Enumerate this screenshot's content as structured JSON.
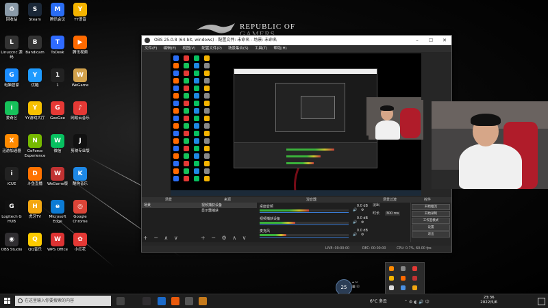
{
  "wallpaper": {
    "brand_line1": "REPUBLIC OF",
    "brand_line2": "GAMERS"
  },
  "desktop_icons": [
    {
      "label": "回收站",
      "color": "#8a9aa8",
      "glyph": "♻"
    },
    {
      "label": "Steam",
      "color": "#1b2838",
      "glyph": "S"
    },
    {
      "label": "腾讯会议",
      "color": "#2a6df4",
      "glyph": "M"
    },
    {
      "label": "YY语音",
      "color": "#f5b400",
      "glyph": "Y"
    },
    {
      "label": "Linuxcnc 源码",
      "color": "#333",
      "glyph": "L"
    },
    {
      "label": "Bandicam",
      "color": "#333",
      "glyph": "B"
    },
    {
      "label": "ToDesk",
      "color": "#2f6bff",
      "glyph": "T"
    },
    {
      "label": "腾讯视频",
      "color": "#ff6a00",
      "glyph": "▶"
    },
    {
      "label": "电脑管家",
      "color": "#1a8cff",
      "glyph": "G"
    },
    {
      "label": "优酷",
      "color": "#1e9bff",
      "glyph": "Y"
    },
    {
      "label": "1",
      "color": "#222",
      "glyph": "1"
    },
    {
      "label": "WeGame",
      "color": "#d2a14b",
      "glyph": "W"
    },
    {
      "label": "爱奇艺",
      "color": "#16c25a",
      "glyph": "i"
    },
    {
      "label": "YY游戏大厅",
      "color": "#f6c000",
      "glyph": "Y"
    },
    {
      "label": "GeeGee",
      "color": "#e53935",
      "glyph": "G"
    },
    {
      "label": "网易云音乐",
      "color": "#e53935",
      "glyph": "♪"
    },
    {
      "label": "迅游加速器",
      "color": "#ff8a00",
      "glyph": "X"
    },
    {
      "label": "GeForce Experience",
      "color": "#76b900",
      "glyph": "N"
    },
    {
      "label": "微信",
      "color": "#07c160",
      "glyph": "W"
    },
    {
      "label": "剪映专业版",
      "color": "#111",
      "glyph": "J"
    },
    {
      "label": "iCUE",
      "color": "#222",
      "glyph": "i"
    },
    {
      "label": "斗鱼直播",
      "color": "#ff7200",
      "glyph": "D"
    },
    {
      "label": "WeGame版",
      "color": "#c13232",
      "glyph": "W"
    },
    {
      "label": "酷狗音乐",
      "color": "#1e88e5",
      "glyph": "K"
    },
    {
      "label": "Logitech G HUB",
      "color": "#111",
      "glyph": "G"
    },
    {
      "label": "虎牙TV",
      "color": "#f3a712",
      "glyph": "H"
    },
    {
      "label": "Microsoft Edge",
      "color": "#0c7bd4",
      "glyph": "e"
    },
    {
      "label": "Google Chrome",
      "color": "#db4437",
      "glyph": "◎"
    },
    {
      "label": "OBS Studio",
      "color": "#302e31",
      "glyph": "◉"
    },
    {
      "label": "QQ音乐",
      "color": "#ffcc00",
      "glyph": "Q"
    },
    {
      "label": "WPS Office",
      "color": "#d33",
      "glyph": "W"
    },
    {
      "label": "小红花",
      "color": "#e53935",
      "glyph": "✿"
    }
  ],
  "obs": {
    "title": "OBS 25.0.8 (64-bit, windows) - 配置文件: 未命名 - 场景: 未命名",
    "menu": [
      "文件(F)",
      "编辑(E)",
      "视图(V)",
      "配置文件(P)",
      "场景集合(S)",
      "工具(T)",
      "帮助(H)"
    ],
    "docks": {
      "scenes": "场景",
      "sources": "来源",
      "mixer": "混音器",
      "transitions": "场景过渡",
      "controls": "控件"
    },
    "scenes": [
      "场景"
    ],
    "sources": [
      "视频捕获设备",
      "显示器捕获"
    ],
    "mixer_tracks": [
      {
        "name": "桌面音频",
        "level": "0.0 dB",
        "fill": 0.55
      },
      {
        "name": "视频捕获设备",
        "level": "0.0 dB",
        "fill": 0.4
      },
      {
        "name": "麦克风",
        "level": "0.0 dB",
        "fill": 0.3
      }
    ],
    "transition": {
      "type": "淡出",
      "duration_label": "时长",
      "duration": "300 ms"
    },
    "controls": [
      "开始推流",
      "开始录制",
      "工作室模式",
      "设置",
      "退出"
    ],
    "status": {
      "live": "LIVE: 00:00:00",
      "rec": "REC: 00:00:00",
      "cpu": "CPU: 0.7%, 60.00 fps"
    }
  },
  "taskbar": {
    "search_placeholder": "在这里输入你要搜索的内容",
    "weather": "6°C 多云",
    "time": "23:36",
    "date": "2022/5/6",
    "float_badge": "25"
  }
}
